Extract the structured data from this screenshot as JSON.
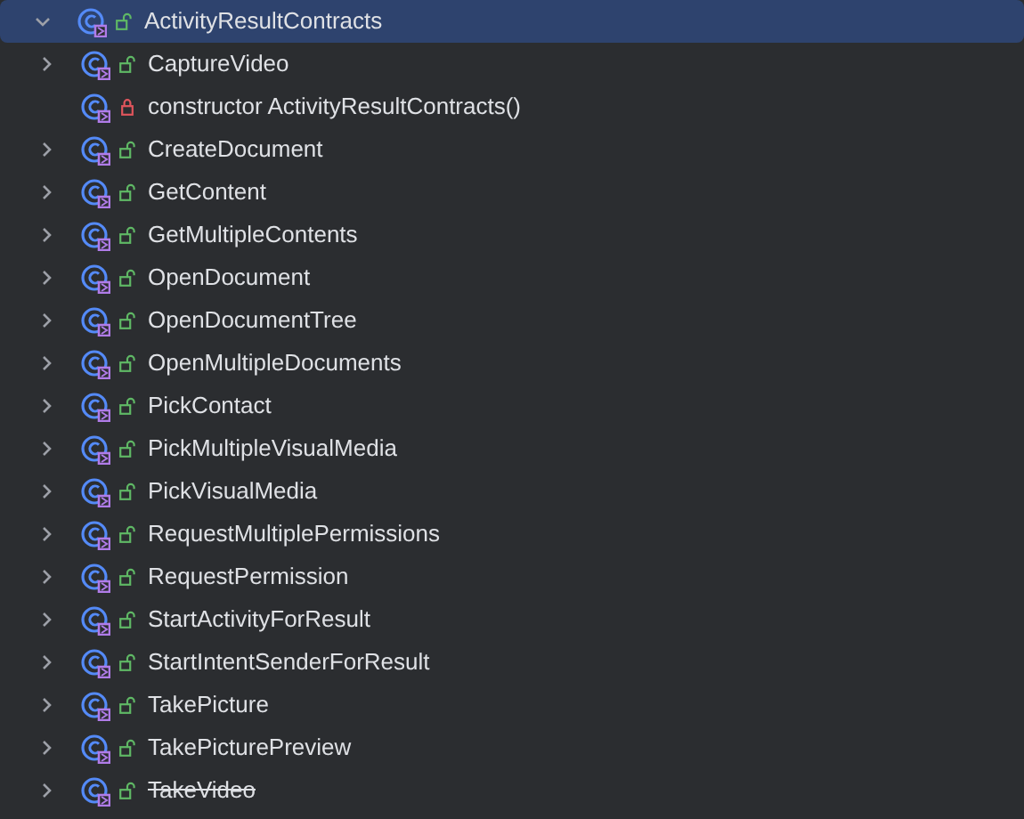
{
  "tree": {
    "label": "ActivityResultContracts",
    "private": false,
    "expanded": true,
    "selected": true,
    "children": [
      {
        "label": "CaptureVideo",
        "private": false,
        "expanded": false,
        "deprecated": false
      },
      {
        "label": "constructor ActivityResultContracts()",
        "private": true,
        "deprecated": false
      },
      {
        "label": "CreateDocument",
        "private": false,
        "expanded": false,
        "deprecated": false
      },
      {
        "label": "GetContent",
        "private": false,
        "expanded": false,
        "deprecated": false
      },
      {
        "label": "GetMultipleContents",
        "private": false,
        "expanded": false,
        "deprecated": false
      },
      {
        "label": "OpenDocument",
        "private": false,
        "expanded": false,
        "deprecated": false
      },
      {
        "label": "OpenDocumentTree",
        "private": false,
        "expanded": false,
        "deprecated": false
      },
      {
        "label": "OpenMultipleDocuments",
        "private": false,
        "expanded": false,
        "deprecated": false
      },
      {
        "label": "PickContact",
        "private": false,
        "expanded": false,
        "deprecated": false
      },
      {
        "label": "PickMultipleVisualMedia",
        "private": false,
        "expanded": false,
        "deprecated": false
      },
      {
        "label": "PickVisualMedia",
        "private": false,
        "expanded": false,
        "deprecated": false
      },
      {
        "label": "RequestMultiplePermissions",
        "private": false,
        "expanded": false,
        "deprecated": false
      },
      {
        "label": "RequestPermission",
        "private": false,
        "expanded": false,
        "deprecated": false
      },
      {
        "label": "StartActivityForResult",
        "private": false,
        "expanded": false,
        "deprecated": false
      },
      {
        "label": "StartIntentSenderForResult",
        "private": false,
        "expanded": false,
        "deprecated": false
      },
      {
        "label": "TakePicture",
        "private": false,
        "expanded": false,
        "deprecated": false
      },
      {
        "label": "TakePicturePreview",
        "private": false,
        "expanded": false,
        "deprecated": false
      },
      {
        "label": "TakeVideo",
        "private": false,
        "expanded": false,
        "deprecated": true
      }
    ]
  }
}
